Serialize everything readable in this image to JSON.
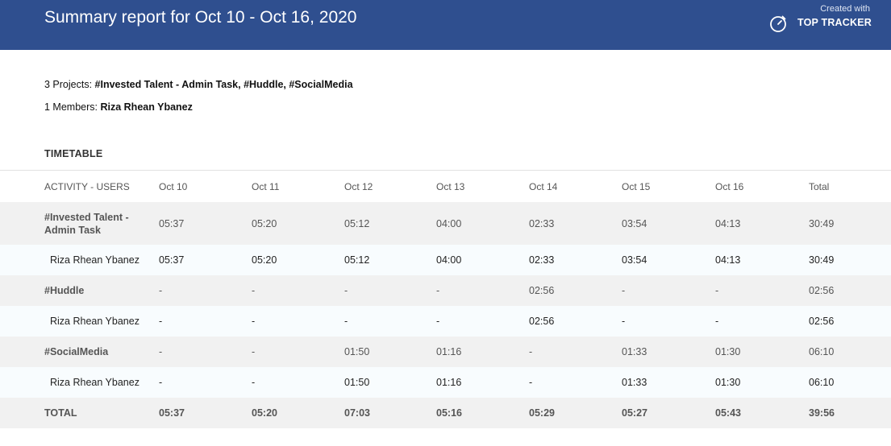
{
  "header": {
    "title": "Summary report for Oct 10 - Oct 16, 2020",
    "created_with": "Created with",
    "brand": "TOP TRACKER",
    "logo_icon": "stopwatch-icon",
    "bg_color": "#2f4f8f"
  },
  "summary": {
    "projects_label": "3 Projects:",
    "projects_value": "#Invested Talent - Admin Task, #Huddle, #SocialMedia",
    "members_label": "1 Members:",
    "members_value": "Riza Rhean Ybanez"
  },
  "timetable": {
    "title": "TIMETABLE",
    "columns": [
      "ACTIVITY - USERS",
      "Oct 10",
      "Oct 11",
      "Oct 12",
      "Oct 13",
      "Oct 14",
      "Oct 15",
      "Oct 16",
      "Total"
    ],
    "rows": [
      {
        "type": "project",
        "cells": [
          "#Invested Talent - Admin Task",
          "05:37",
          "05:20",
          "05:12",
          "04:00",
          "02:33",
          "03:54",
          "04:13",
          "30:49"
        ]
      },
      {
        "type": "user",
        "cells": [
          "Riza Rhean Ybanez",
          "05:37",
          "05:20",
          "05:12",
          "04:00",
          "02:33",
          "03:54",
          "04:13",
          "30:49"
        ]
      },
      {
        "type": "project",
        "cells": [
          "#Huddle",
          "-",
          "-",
          "-",
          "-",
          "02:56",
          "-",
          "-",
          "02:56"
        ]
      },
      {
        "type": "user",
        "cells": [
          "Riza Rhean Ybanez",
          "-",
          "-",
          "-",
          "-",
          "02:56",
          "-",
          "-",
          "02:56"
        ]
      },
      {
        "type": "project",
        "cells": [
          "#SocialMedia",
          "-",
          "-",
          "01:50",
          "01:16",
          "-",
          "01:33",
          "01:30",
          "06:10"
        ]
      },
      {
        "type": "user",
        "cells": [
          "Riza Rhean Ybanez",
          "-",
          "-",
          "01:50",
          "01:16",
          "-",
          "01:33",
          "01:30",
          "06:10"
        ]
      },
      {
        "type": "total",
        "cells": [
          "TOTAL",
          "05:37",
          "05:20",
          "07:03",
          "05:16",
          "05:29",
          "05:27",
          "05:43",
          "39:56"
        ]
      }
    ]
  }
}
